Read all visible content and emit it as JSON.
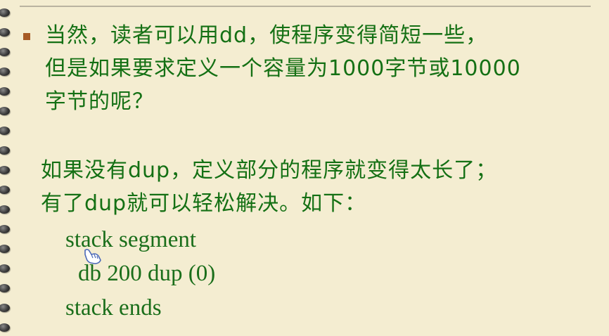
{
  "slide": {
    "paragraph1": [
      "当然，读者可以用dd，使程序变得简短一些，",
      "但是如果要求定义一个容量为1000字节或10000",
      "字节的呢？"
    ],
    "paragraph2": [
      "如果没有dup，定义部分的程序就变得太长了；",
      "有了dup就可以轻松解决。如下："
    ],
    "code": [
      "stack segment",
      "db 200 dup (0)",
      "stack ends"
    ]
  },
  "colors": {
    "background": "#f4edd1",
    "text": "#147014",
    "bullet": "#a65a24"
  },
  "icons": {
    "bullet": "square-bullet-icon",
    "cursor": "hand-pointer-icon",
    "binding": "notebook-ring-icon"
  }
}
